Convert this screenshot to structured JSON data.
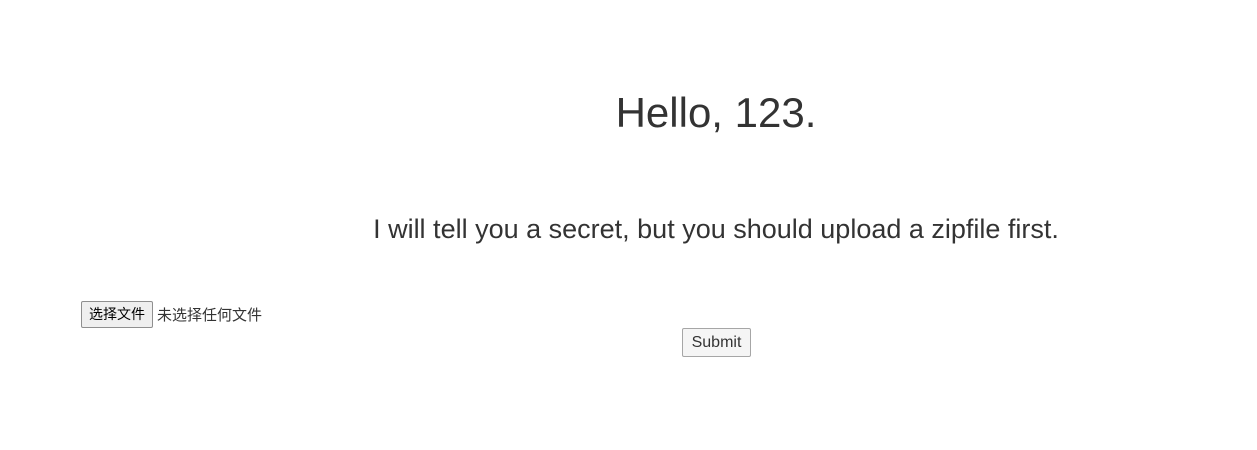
{
  "greeting": "Hello, 123.",
  "message": "I will tell you a secret, but you should upload a zipfile first.",
  "upload": {
    "choose_file_label": "选择文件",
    "no_file_text": "未选择任何文件"
  },
  "submit_label": "Submit"
}
